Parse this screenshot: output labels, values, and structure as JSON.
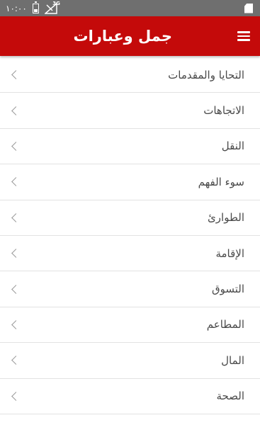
{
  "status_bar": {
    "time": "١٠:٠٠",
    "network": "3G",
    "icons": [
      "battery-icon",
      "signal-icon",
      "sdcard-icon"
    ]
  },
  "app_bar": {
    "title": "جمل وعبارات",
    "menu_icon": "hamburger-menu-icon",
    "color": "#c40a0a"
  },
  "categories": [
    {
      "label": "التحايا والمقدمات"
    },
    {
      "label": "الاتجاهات"
    },
    {
      "label": "النقل"
    },
    {
      "label": "سوء الفهم"
    },
    {
      "label": "الطوارئ"
    },
    {
      "label": "الإقامة"
    },
    {
      "label": "التسوق"
    },
    {
      "label": "المطاعم"
    },
    {
      "label": "المال"
    },
    {
      "label": "الصحة"
    }
  ],
  "row_icon": "chevron-left-icon"
}
